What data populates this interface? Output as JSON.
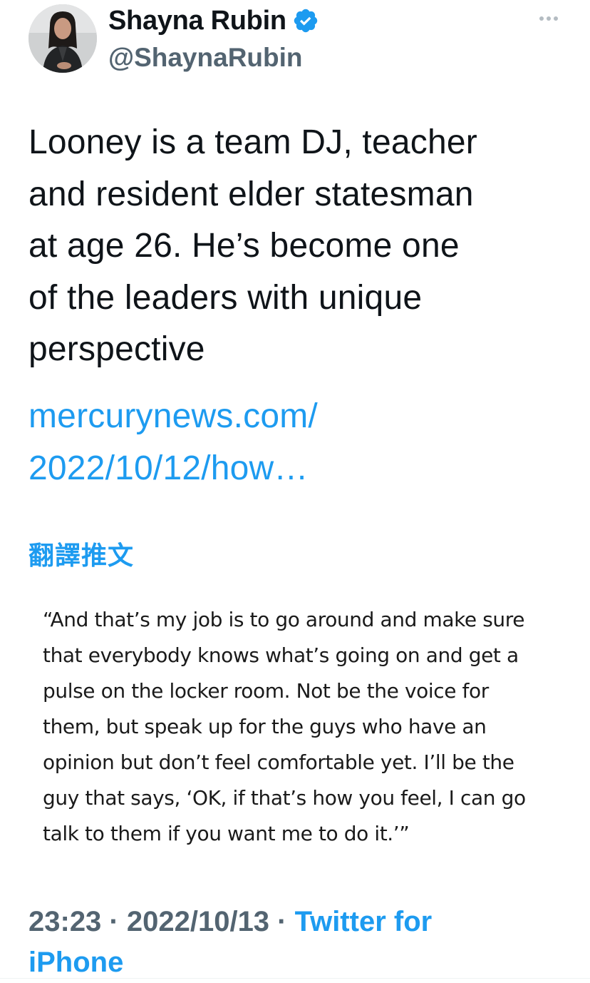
{
  "author": {
    "display_name": "Shayna Rubin",
    "handle": "@ShaynaRubin",
    "verified_icon": "verified-badge-icon",
    "avatar_icon": "avatar-photo"
  },
  "menu_icon": "more-options-icon",
  "tweet": {
    "lines": [
      "Looney is a team DJ, teacher",
      "and resident elder statesman",
      "at age 26. He’s become one",
      "of the leaders with unique",
      "perspective"
    ],
    "link_lines": [
      "mercurynews.com/",
      "2022/10/12/how…"
    ],
    "translate_label": "翻譯推文"
  },
  "quote_image": {
    "lines": [
      "“And that’s my job is to go around and make sure",
      "that everybody knows what’s going on and get a",
      "pulse on the locker room. Not be the voice for",
      "them, but speak up for the guys who have an",
      "opinion but don’t feel comfortable yet. I’ll be the",
      "guy that says, ‘OK, if that’s how you feel, I can go",
      "talk to them if you want me to do it.’”"
    ]
  },
  "meta": {
    "time": "23:23",
    "separator": " · ",
    "date": "2022/10/13",
    "source_line1": "Twitter for",
    "source_line2": "iPhone"
  },
  "colors": {
    "accent": "#1d9bf0",
    "text": "#0f1419",
    "secondary": "#536471"
  }
}
